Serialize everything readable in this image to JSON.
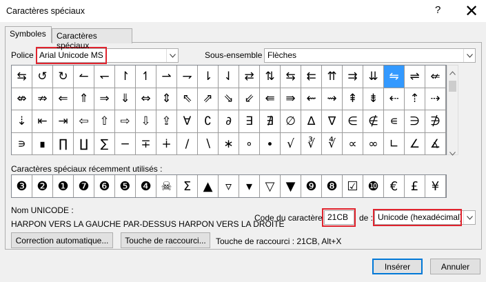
{
  "window": {
    "title": "Caractères spéciaux",
    "help": "?",
    "close": "✕"
  },
  "tabs": [
    {
      "label": "Symboles"
    },
    {
      "label": "Caractères spéciaux"
    }
  ],
  "font": {
    "label": "Police :",
    "value": "Arial Unicode MS"
  },
  "subset": {
    "label": "Sous-ensemble :",
    "value": "Flèches"
  },
  "symbols": [
    [
      "⇆",
      "↺",
      "↻",
      "↼",
      "↽",
      "↾",
      "↿",
      "⇀",
      "⇁",
      "⇂",
      "⇃",
      "⇄",
      "⇅",
      "⇆",
      "⇇",
      "⇈",
      "⇉",
      "⇊",
      "⇋",
      "⇌",
      "⇍"
    ],
    [
      "⇎",
      "⇏",
      "⇐",
      "⇑",
      "⇒",
      "⇓",
      "⇔",
      "⇕",
      "⇖",
      "⇗",
      "⇘",
      "⇙",
      "⇚",
      "⇛",
      "⇜",
      "⇝",
      "⇞",
      "⇟",
      "⇠",
      "⇡",
      "⇢"
    ],
    [
      "⇣",
      "⇤",
      "⇥",
      "⇦",
      "⇧",
      "⇨",
      "⇩",
      "⇪",
      "∀",
      "∁",
      "∂",
      "∃",
      "∄",
      "∅",
      "∆",
      "∇",
      "∈",
      "∉",
      "∊",
      "∋",
      "∌"
    ],
    [
      "∍",
      "∎",
      "∏",
      "∐",
      "∑",
      "−",
      "∓",
      "∔",
      "∕",
      "∖",
      "∗",
      "∘",
      "∙",
      "√",
      "∛",
      "∜",
      "∝",
      "∞",
      "∟",
      "∠",
      "∡"
    ]
  ],
  "selected_symbol": {
    "row": 0,
    "col": 18
  },
  "recent": {
    "label": "Caractères spéciaux récemment utilisés :",
    "items": [
      "❸",
      "❷",
      "❶",
      "❼",
      "❻",
      "❺",
      "❹",
      "☠",
      "Σ",
      "▲",
      "▿",
      "▾",
      "▽",
      "▼",
      "❾",
      "❽",
      "☑",
      "❿",
      "€",
      "£",
      "¥"
    ]
  },
  "unicode_name": {
    "label": "Nom UNICODE :",
    "value": "HARPON VERS LA GAUCHE PAR-DESSUS HARPON VERS LA DROITE"
  },
  "char_code": {
    "label": "Code du caractère :",
    "value": "21CB"
  },
  "from": {
    "label": "de :",
    "value": "Unicode (hexadécimal)"
  },
  "buttons": {
    "autocorrect": "Correction automatique...",
    "shortcut": "Touche de raccourci...",
    "insert": "Insérer",
    "cancel": "Annuler"
  },
  "shortcut_text": "Touche de raccourci : 21CB, Alt+X",
  "colors": {
    "highlight": "#e0232d",
    "selection": "#3399ff",
    "default_button": "#0078d7"
  }
}
